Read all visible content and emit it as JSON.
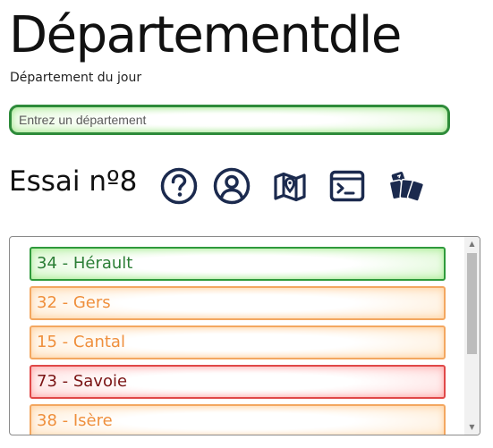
{
  "app": {
    "title": "Départementdle",
    "subtitle": "Département du jour"
  },
  "search": {
    "placeholder": "Entrez un département",
    "value": ""
  },
  "attempt": {
    "label": "Essai nº8"
  },
  "toolbar": {
    "icons": [
      "help-icon",
      "user-icon",
      "map-icon",
      "terminal-icon",
      "cards-icon"
    ]
  },
  "guesses": [
    {
      "label": "34 - Hérault",
      "status": "green"
    },
    {
      "label": "32 - Gers",
      "status": "orange"
    },
    {
      "label": "15 - Cantal",
      "status": "orange"
    },
    {
      "label": "73 - Savoie",
      "status": "red"
    },
    {
      "label": "38 - Isère",
      "status": "orange"
    }
  ],
  "colors": {
    "accent_dark": "#1b2a4e",
    "green": "#2f9a3c",
    "orange": "#f3a760",
    "red": "#e04848"
  },
  "scroll": {
    "thumb_fraction": 0.54
  }
}
